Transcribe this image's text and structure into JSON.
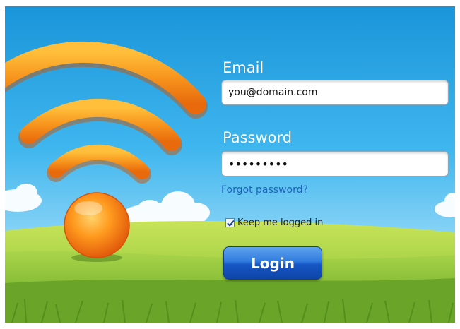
{
  "form": {
    "email_label": "Email",
    "email_value": "you@domain.com",
    "password_label": "Password",
    "password_value": "•••••••••",
    "forgot_link": "Forgot password?",
    "keep_logged_in_label": "Keep me logged in",
    "keep_logged_in_checked": true,
    "login_label": "Login"
  },
  "colors": {
    "sky_top": "#1e9fe0",
    "grass": "#8cc63f",
    "wifi_orange": "#f7941d",
    "link": "#1e63b8",
    "button": "#1656c4"
  },
  "icons": [
    "wifi-icon",
    "checkbox-icon"
  ]
}
